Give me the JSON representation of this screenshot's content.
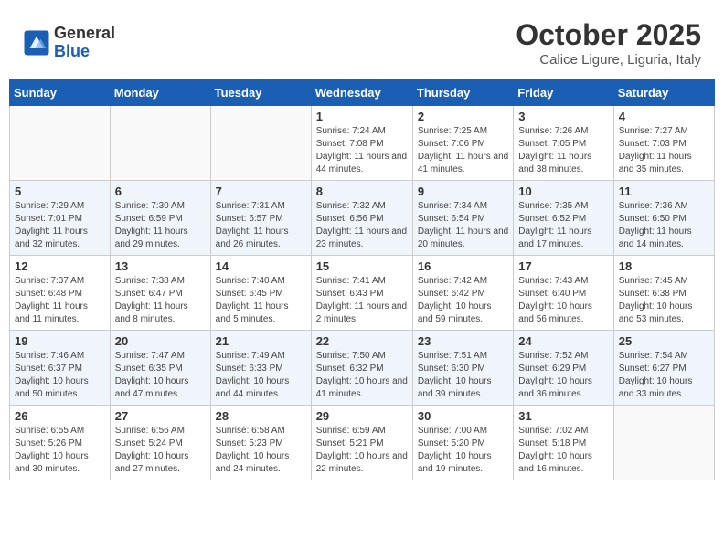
{
  "header": {
    "logo_general": "General",
    "logo_blue": "Blue",
    "month_title": "October 2025",
    "location": "Calice Ligure, Liguria, Italy"
  },
  "days_of_week": [
    "Sunday",
    "Monday",
    "Tuesday",
    "Wednesday",
    "Thursday",
    "Friday",
    "Saturday"
  ],
  "weeks": [
    [
      {
        "day": "",
        "info": ""
      },
      {
        "day": "",
        "info": ""
      },
      {
        "day": "",
        "info": ""
      },
      {
        "day": "1",
        "info": "Sunrise: 7:24 AM\nSunset: 7:08 PM\nDaylight: 11 hours and 44 minutes."
      },
      {
        "day": "2",
        "info": "Sunrise: 7:25 AM\nSunset: 7:06 PM\nDaylight: 11 hours and 41 minutes."
      },
      {
        "day": "3",
        "info": "Sunrise: 7:26 AM\nSunset: 7:05 PM\nDaylight: 11 hours and 38 minutes."
      },
      {
        "day": "4",
        "info": "Sunrise: 7:27 AM\nSunset: 7:03 PM\nDaylight: 11 hours and 35 minutes."
      }
    ],
    [
      {
        "day": "5",
        "info": "Sunrise: 7:29 AM\nSunset: 7:01 PM\nDaylight: 11 hours and 32 minutes."
      },
      {
        "day": "6",
        "info": "Sunrise: 7:30 AM\nSunset: 6:59 PM\nDaylight: 11 hours and 29 minutes."
      },
      {
        "day": "7",
        "info": "Sunrise: 7:31 AM\nSunset: 6:57 PM\nDaylight: 11 hours and 26 minutes."
      },
      {
        "day": "8",
        "info": "Sunrise: 7:32 AM\nSunset: 6:56 PM\nDaylight: 11 hours and 23 minutes."
      },
      {
        "day": "9",
        "info": "Sunrise: 7:34 AM\nSunset: 6:54 PM\nDaylight: 11 hours and 20 minutes."
      },
      {
        "day": "10",
        "info": "Sunrise: 7:35 AM\nSunset: 6:52 PM\nDaylight: 11 hours and 17 minutes."
      },
      {
        "day": "11",
        "info": "Sunrise: 7:36 AM\nSunset: 6:50 PM\nDaylight: 11 hours and 14 minutes."
      }
    ],
    [
      {
        "day": "12",
        "info": "Sunrise: 7:37 AM\nSunset: 6:48 PM\nDaylight: 11 hours and 11 minutes."
      },
      {
        "day": "13",
        "info": "Sunrise: 7:38 AM\nSunset: 6:47 PM\nDaylight: 11 hours and 8 minutes."
      },
      {
        "day": "14",
        "info": "Sunrise: 7:40 AM\nSunset: 6:45 PM\nDaylight: 11 hours and 5 minutes."
      },
      {
        "day": "15",
        "info": "Sunrise: 7:41 AM\nSunset: 6:43 PM\nDaylight: 11 hours and 2 minutes."
      },
      {
        "day": "16",
        "info": "Sunrise: 7:42 AM\nSunset: 6:42 PM\nDaylight: 10 hours and 59 minutes."
      },
      {
        "day": "17",
        "info": "Sunrise: 7:43 AM\nSunset: 6:40 PM\nDaylight: 10 hours and 56 minutes."
      },
      {
        "day": "18",
        "info": "Sunrise: 7:45 AM\nSunset: 6:38 PM\nDaylight: 10 hours and 53 minutes."
      }
    ],
    [
      {
        "day": "19",
        "info": "Sunrise: 7:46 AM\nSunset: 6:37 PM\nDaylight: 10 hours and 50 minutes."
      },
      {
        "day": "20",
        "info": "Sunrise: 7:47 AM\nSunset: 6:35 PM\nDaylight: 10 hours and 47 minutes."
      },
      {
        "day": "21",
        "info": "Sunrise: 7:49 AM\nSunset: 6:33 PM\nDaylight: 10 hours and 44 minutes."
      },
      {
        "day": "22",
        "info": "Sunrise: 7:50 AM\nSunset: 6:32 PM\nDaylight: 10 hours and 41 minutes."
      },
      {
        "day": "23",
        "info": "Sunrise: 7:51 AM\nSunset: 6:30 PM\nDaylight: 10 hours and 39 minutes."
      },
      {
        "day": "24",
        "info": "Sunrise: 7:52 AM\nSunset: 6:29 PM\nDaylight: 10 hours and 36 minutes."
      },
      {
        "day": "25",
        "info": "Sunrise: 7:54 AM\nSunset: 6:27 PM\nDaylight: 10 hours and 33 minutes."
      }
    ],
    [
      {
        "day": "26",
        "info": "Sunrise: 6:55 AM\nSunset: 5:26 PM\nDaylight: 10 hours and 30 minutes."
      },
      {
        "day": "27",
        "info": "Sunrise: 6:56 AM\nSunset: 5:24 PM\nDaylight: 10 hours and 27 minutes."
      },
      {
        "day": "28",
        "info": "Sunrise: 6:58 AM\nSunset: 5:23 PM\nDaylight: 10 hours and 24 minutes."
      },
      {
        "day": "29",
        "info": "Sunrise: 6:59 AM\nSunset: 5:21 PM\nDaylight: 10 hours and 22 minutes."
      },
      {
        "day": "30",
        "info": "Sunrise: 7:00 AM\nSunset: 5:20 PM\nDaylight: 10 hours and 19 minutes."
      },
      {
        "day": "31",
        "info": "Sunrise: 7:02 AM\nSunset: 5:18 PM\nDaylight: 10 hours and 16 minutes."
      },
      {
        "day": "",
        "info": ""
      }
    ]
  ]
}
